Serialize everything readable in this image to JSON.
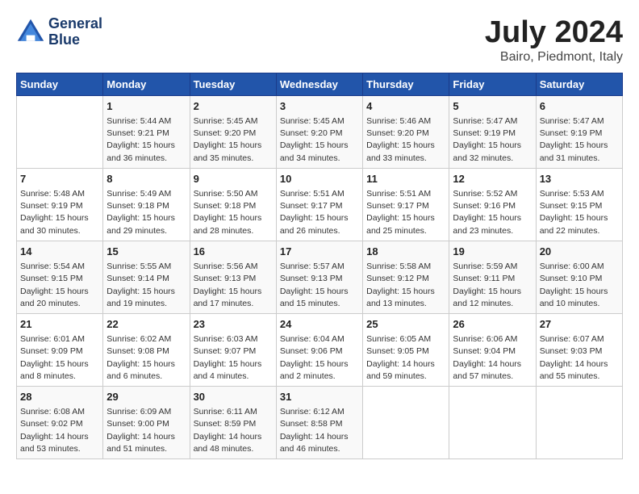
{
  "header": {
    "logo_line1": "General",
    "logo_line2": "Blue",
    "month_title": "July 2024",
    "location": "Bairo, Piedmont, Italy"
  },
  "days_of_week": [
    "Sunday",
    "Monday",
    "Tuesday",
    "Wednesday",
    "Thursday",
    "Friday",
    "Saturday"
  ],
  "weeks": [
    [
      {
        "day": "",
        "info": ""
      },
      {
        "day": "1",
        "info": "Sunrise: 5:44 AM\nSunset: 9:21 PM\nDaylight: 15 hours\nand 36 minutes."
      },
      {
        "day": "2",
        "info": "Sunrise: 5:45 AM\nSunset: 9:20 PM\nDaylight: 15 hours\nand 35 minutes."
      },
      {
        "day": "3",
        "info": "Sunrise: 5:45 AM\nSunset: 9:20 PM\nDaylight: 15 hours\nand 34 minutes."
      },
      {
        "day": "4",
        "info": "Sunrise: 5:46 AM\nSunset: 9:20 PM\nDaylight: 15 hours\nand 33 minutes."
      },
      {
        "day": "5",
        "info": "Sunrise: 5:47 AM\nSunset: 9:19 PM\nDaylight: 15 hours\nand 32 minutes."
      },
      {
        "day": "6",
        "info": "Sunrise: 5:47 AM\nSunset: 9:19 PM\nDaylight: 15 hours\nand 31 minutes."
      }
    ],
    [
      {
        "day": "7",
        "info": "Sunrise: 5:48 AM\nSunset: 9:19 PM\nDaylight: 15 hours\nand 30 minutes."
      },
      {
        "day": "8",
        "info": "Sunrise: 5:49 AM\nSunset: 9:18 PM\nDaylight: 15 hours\nand 29 minutes."
      },
      {
        "day": "9",
        "info": "Sunrise: 5:50 AM\nSunset: 9:18 PM\nDaylight: 15 hours\nand 28 minutes."
      },
      {
        "day": "10",
        "info": "Sunrise: 5:51 AM\nSunset: 9:17 PM\nDaylight: 15 hours\nand 26 minutes."
      },
      {
        "day": "11",
        "info": "Sunrise: 5:51 AM\nSunset: 9:17 PM\nDaylight: 15 hours\nand 25 minutes."
      },
      {
        "day": "12",
        "info": "Sunrise: 5:52 AM\nSunset: 9:16 PM\nDaylight: 15 hours\nand 23 minutes."
      },
      {
        "day": "13",
        "info": "Sunrise: 5:53 AM\nSunset: 9:15 PM\nDaylight: 15 hours\nand 22 minutes."
      }
    ],
    [
      {
        "day": "14",
        "info": "Sunrise: 5:54 AM\nSunset: 9:15 PM\nDaylight: 15 hours\nand 20 minutes."
      },
      {
        "day": "15",
        "info": "Sunrise: 5:55 AM\nSunset: 9:14 PM\nDaylight: 15 hours\nand 19 minutes."
      },
      {
        "day": "16",
        "info": "Sunrise: 5:56 AM\nSunset: 9:13 PM\nDaylight: 15 hours\nand 17 minutes."
      },
      {
        "day": "17",
        "info": "Sunrise: 5:57 AM\nSunset: 9:13 PM\nDaylight: 15 hours\nand 15 minutes."
      },
      {
        "day": "18",
        "info": "Sunrise: 5:58 AM\nSunset: 9:12 PM\nDaylight: 15 hours\nand 13 minutes."
      },
      {
        "day": "19",
        "info": "Sunrise: 5:59 AM\nSunset: 9:11 PM\nDaylight: 15 hours\nand 12 minutes."
      },
      {
        "day": "20",
        "info": "Sunrise: 6:00 AM\nSunset: 9:10 PM\nDaylight: 15 hours\nand 10 minutes."
      }
    ],
    [
      {
        "day": "21",
        "info": "Sunrise: 6:01 AM\nSunset: 9:09 PM\nDaylight: 15 hours\nand 8 minutes."
      },
      {
        "day": "22",
        "info": "Sunrise: 6:02 AM\nSunset: 9:08 PM\nDaylight: 15 hours\nand 6 minutes."
      },
      {
        "day": "23",
        "info": "Sunrise: 6:03 AM\nSunset: 9:07 PM\nDaylight: 15 hours\nand 4 minutes."
      },
      {
        "day": "24",
        "info": "Sunrise: 6:04 AM\nSunset: 9:06 PM\nDaylight: 15 hours\nand 2 minutes."
      },
      {
        "day": "25",
        "info": "Sunrise: 6:05 AM\nSunset: 9:05 PM\nDaylight: 14 hours\nand 59 minutes."
      },
      {
        "day": "26",
        "info": "Sunrise: 6:06 AM\nSunset: 9:04 PM\nDaylight: 14 hours\nand 57 minutes."
      },
      {
        "day": "27",
        "info": "Sunrise: 6:07 AM\nSunset: 9:03 PM\nDaylight: 14 hours\nand 55 minutes."
      }
    ],
    [
      {
        "day": "28",
        "info": "Sunrise: 6:08 AM\nSunset: 9:02 PM\nDaylight: 14 hours\nand 53 minutes."
      },
      {
        "day": "29",
        "info": "Sunrise: 6:09 AM\nSunset: 9:00 PM\nDaylight: 14 hours\nand 51 minutes."
      },
      {
        "day": "30",
        "info": "Sunrise: 6:11 AM\nSunset: 8:59 PM\nDaylight: 14 hours\nand 48 minutes."
      },
      {
        "day": "31",
        "info": "Sunrise: 6:12 AM\nSunset: 8:58 PM\nDaylight: 14 hours\nand 46 minutes."
      },
      {
        "day": "",
        "info": ""
      },
      {
        "day": "",
        "info": ""
      },
      {
        "day": "",
        "info": ""
      }
    ]
  ]
}
